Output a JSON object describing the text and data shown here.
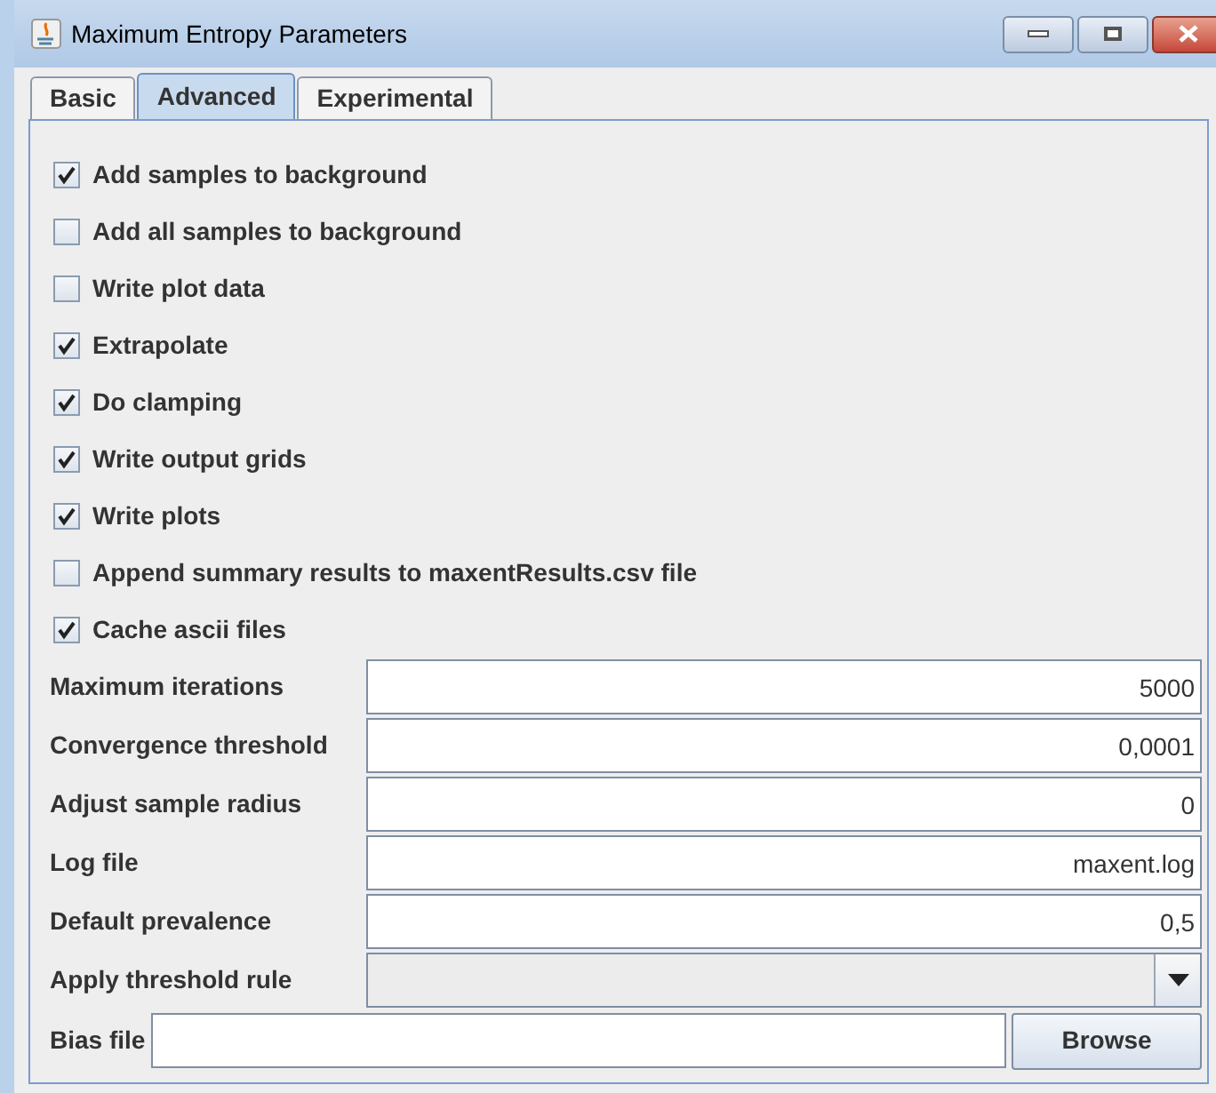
{
  "window": {
    "title": "Maximum Entropy Parameters"
  },
  "tabs": [
    {
      "label": "Basic",
      "selected": false
    },
    {
      "label": "Advanced",
      "selected": true
    },
    {
      "label": "Experimental",
      "selected": false
    }
  ],
  "options": [
    {
      "label": "Add samples to background",
      "checked": true
    },
    {
      "label": "Add all samples to background",
      "checked": false
    },
    {
      "label": "Write plot data",
      "checked": false
    },
    {
      "label": "Extrapolate",
      "checked": true
    },
    {
      "label": "Do clamping",
      "checked": true
    },
    {
      "label": "Write output grids",
      "checked": true
    },
    {
      "label": "Write plots",
      "checked": true
    },
    {
      "label": "Append summary results to maxentResults.csv file",
      "checked": false
    },
    {
      "label": "Cache ascii files",
      "checked": true
    }
  ],
  "fields": [
    {
      "kind": "text",
      "label": "Maximum iterations",
      "value": "5000"
    },
    {
      "kind": "text",
      "label": "Convergence threshold",
      "value": "0,0001"
    },
    {
      "kind": "text",
      "label": "Adjust sample radius",
      "value": "0"
    },
    {
      "kind": "text",
      "label": "Log file",
      "value": "maxent.log"
    },
    {
      "kind": "text",
      "label": "Default prevalence",
      "value": "0,5"
    },
    {
      "kind": "dropdown",
      "label": "Apply threshold rule"
    }
  ],
  "bias_file": {
    "label": "Bias file",
    "button": "Browse"
  }
}
